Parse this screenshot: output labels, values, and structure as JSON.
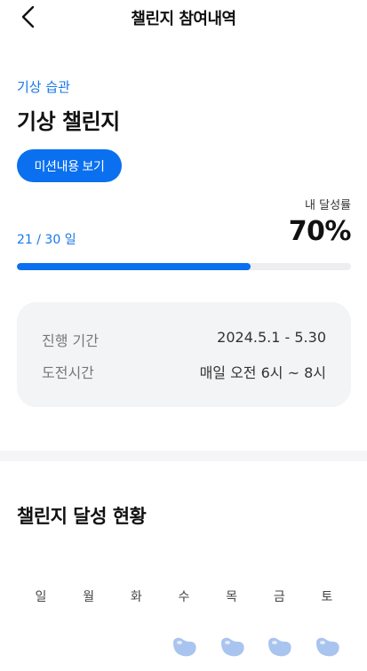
{
  "header": {
    "title": "챌린지 참여내역",
    "back_icon": "chevron-left-icon"
  },
  "challenge": {
    "category": "기상 습관",
    "title": "기상 챌린지",
    "mission_button_label": "미션내용 보기"
  },
  "progress": {
    "rate_label": "내 달성률",
    "days_text": "21 / 30 일",
    "rate_text": "70%",
    "fraction": 0.7,
    "accent_color": "#0a70f0",
    "track_color": "#eeeef0"
  },
  "info": {
    "period_label": "진행 기간",
    "period_value": "2024.5.1 - 5.30",
    "time_label": "도전시간",
    "time_value": "매일 오전 6시 ~ 8시"
  },
  "status": {
    "section_title": "챌린지 달성 현황",
    "weekdays": [
      "일",
      "월",
      "화",
      "수",
      "목",
      "금",
      "토"
    ],
    "stamp_icon": "bean-stamp-icon",
    "stamped_days": [
      false,
      false,
      false,
      true,
      true,
      true,
      true
    ],
    "stamp_color": "#a9c4ee"
  }
}
